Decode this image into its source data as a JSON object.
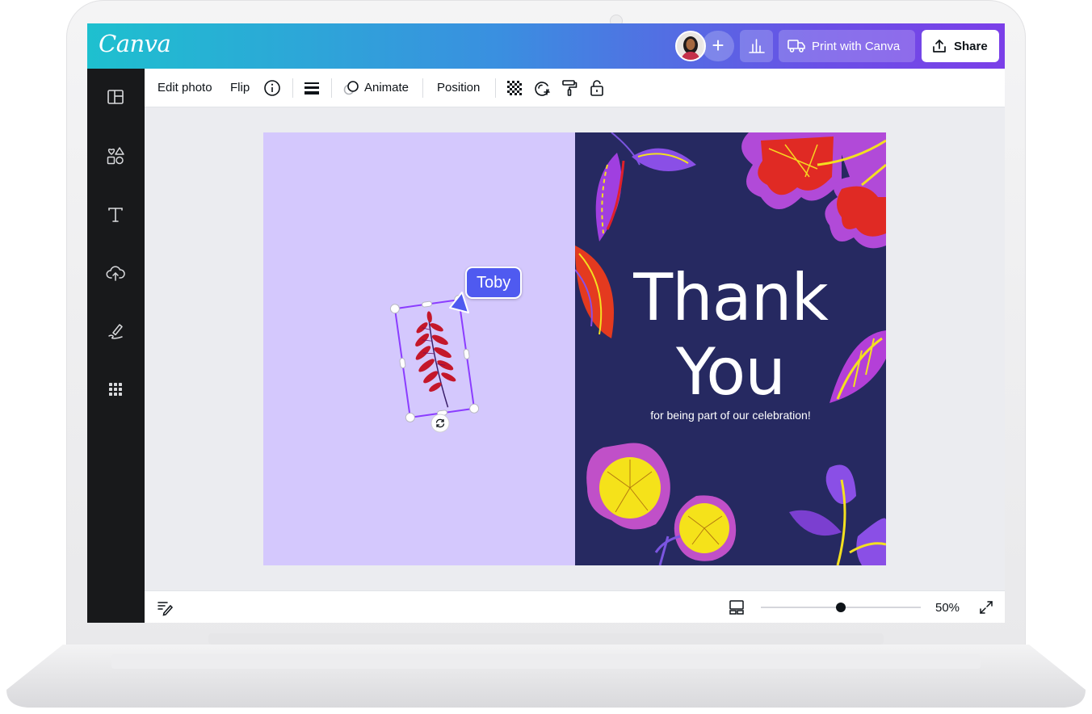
{
  "app": {
    "logo_text": "Canva"
  },
  "topbar": {
    "add_label": "+",
    "print_label": "Print with Canva",
    "share_label": "Share"
  },
  "toolbar": {
    "edit_photo_label": "Edit photo",
    "flip_label": "Flip",
    "animate_label": "Animate",
    "position_label": "Position"
  },
  "sidebar": {
    "items": [
      {
        "icon": "layout-icon"
      },
      {
        "icon": "elements-icon"
      },
      {
        "icon": "text-icon"
      },
      {
        "icon": "upload-cloud-icon"
      },
      {
        "icon": "draw-icon"
      },
      {
        "icon": "apps-grid-icon"
      }
    ]
  },
  "design": {
    "title_line1": "Thank",
    "title_line2": "You",
    "subtitle": "for being part of our celebration!",
    "collaborator_name": "Toby",
    "left_page_color": "#d4c8fd",
    "right_page_color": "#262961"
  },
  "bottombar": {
    "zoom_label": "50%",
    "zoom_level": 0.5
  },
  "colors": {
    "selection": "#8b3dff",
    "cursor": "#4f5af0"
  }
}
